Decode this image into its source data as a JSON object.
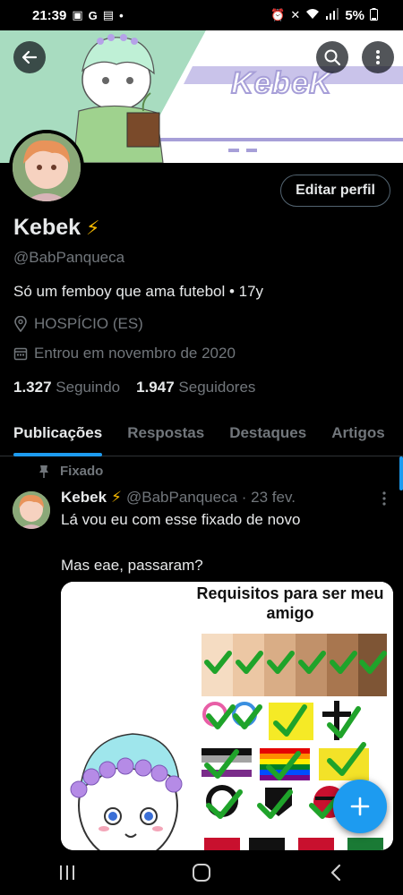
{
  "status_bar": {
    "time": "21:39",
    "left_icons": [
      "gallery-icon",
      "google-icon",
      "shopping-icon",
      "dot-icon"
    ],
    "right_icons": [
      "alarm-icon",
      "mute-icon",
      "wifi-icon",
      "volte-icon",
      "signal-icon"
    ],
    "battery": "5%"
  },
  "header": {
    "banner_text": "KebeK",
    "back_icon": "arrow-left-icon",
    "search_icon": "search-icon",
    "more_icon": "more-vertical-icon"
  },
  "profile": {
    "name": "Kebek",
    "name_badge": "⚡",
    "handle": "@BabPanqueca",
    "bio": "Só um femboy que ama futebol • 17y",
    "location": "HOSPÍCIO (ES)",
    "joined": "Entrou em novembro de 2020",
    "following_count": "1.327",
    "following_label": "Seguindo",
    "followers_count": "1.947",
    "followers_label": "Seguidores",
    "edit_button": "Editar perfil"
  },
  "tabs": [
    {
      "label": "Publicações",
      "active": true
    },
    {
      "label": "Respostas",
      "active": false
    },
    {
      "label": "Destaques",
      "active": false
    },
    {
      "label": "Artigos",
      "active": false
    }
  ],
  "pinned_post": {
    "pinned_label": "Fixado",
    "author_name": "Kebek",
    "author_badge": "⚡",
    "handle_date": "@BabPanqueca · 23 fev.",
    "text_line1": "Lá vou eu com esse fixado de novo",
    "text_line2": "Mas eae, passaram?",
    "image_title": "Requisitos para ser meu amigo"
  },
  "colors": {
    "accent": "#1d9bf0",
    "background": "#000000",
    "muted": "#71767b",
    "text": "#e7e9ea",
    "check": "#1fa32a"
  }
}
